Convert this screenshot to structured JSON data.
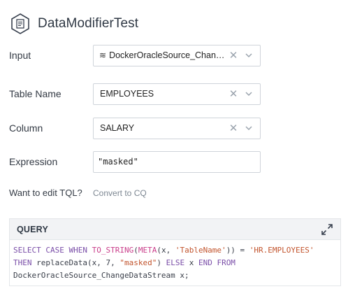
{
  "header": {
    "title": "DataModifierTest",
    "icon": "document-edit-icon"
  },
  "form": {
    "input": {
      "label": "Input",
      "value": "DockerOracleSource_Change...",
      "prefix_icon": "≋"
    },
    "table_name": {
      "label": "Table Name",
      "value": "EMPLOYEES"
    },
    "column": {
      "label": "Column",
      "value": "SALARY"
    },
    "expression": {
      "label": "Expression",
      "value": "\"masked\""
    }
  },
  "tql": {
    "label": "Want to edit TQL?",
    "link": "Convert to CQ"
  },
  "query": {
    "title": "QUERY",
    "line1": {
      "kw1": "SELECT CASE WHEN",
      "fn1": "TO_STRING",
      "p1": "(",
      "fn2": "META",
      "p2": "(x, ",
      "s1": "'TableName'",
      "p3": ")) = ",
      "s2": "'HR.EMPLOYEES'"
    },
    "line2": {
      "kw1": "THEN",
      "t1": " replaceData(x, 7, ",
      "s1": "\"masked\"",
      "t2": ") ",
      "kw2": "ELSE",
      "t3": " x ",
      "kw3": "END FROM"
    },
    "line3": {
      "t1": "DockerOracleSource_ChangeDataStream x;"
    }
  }
}
